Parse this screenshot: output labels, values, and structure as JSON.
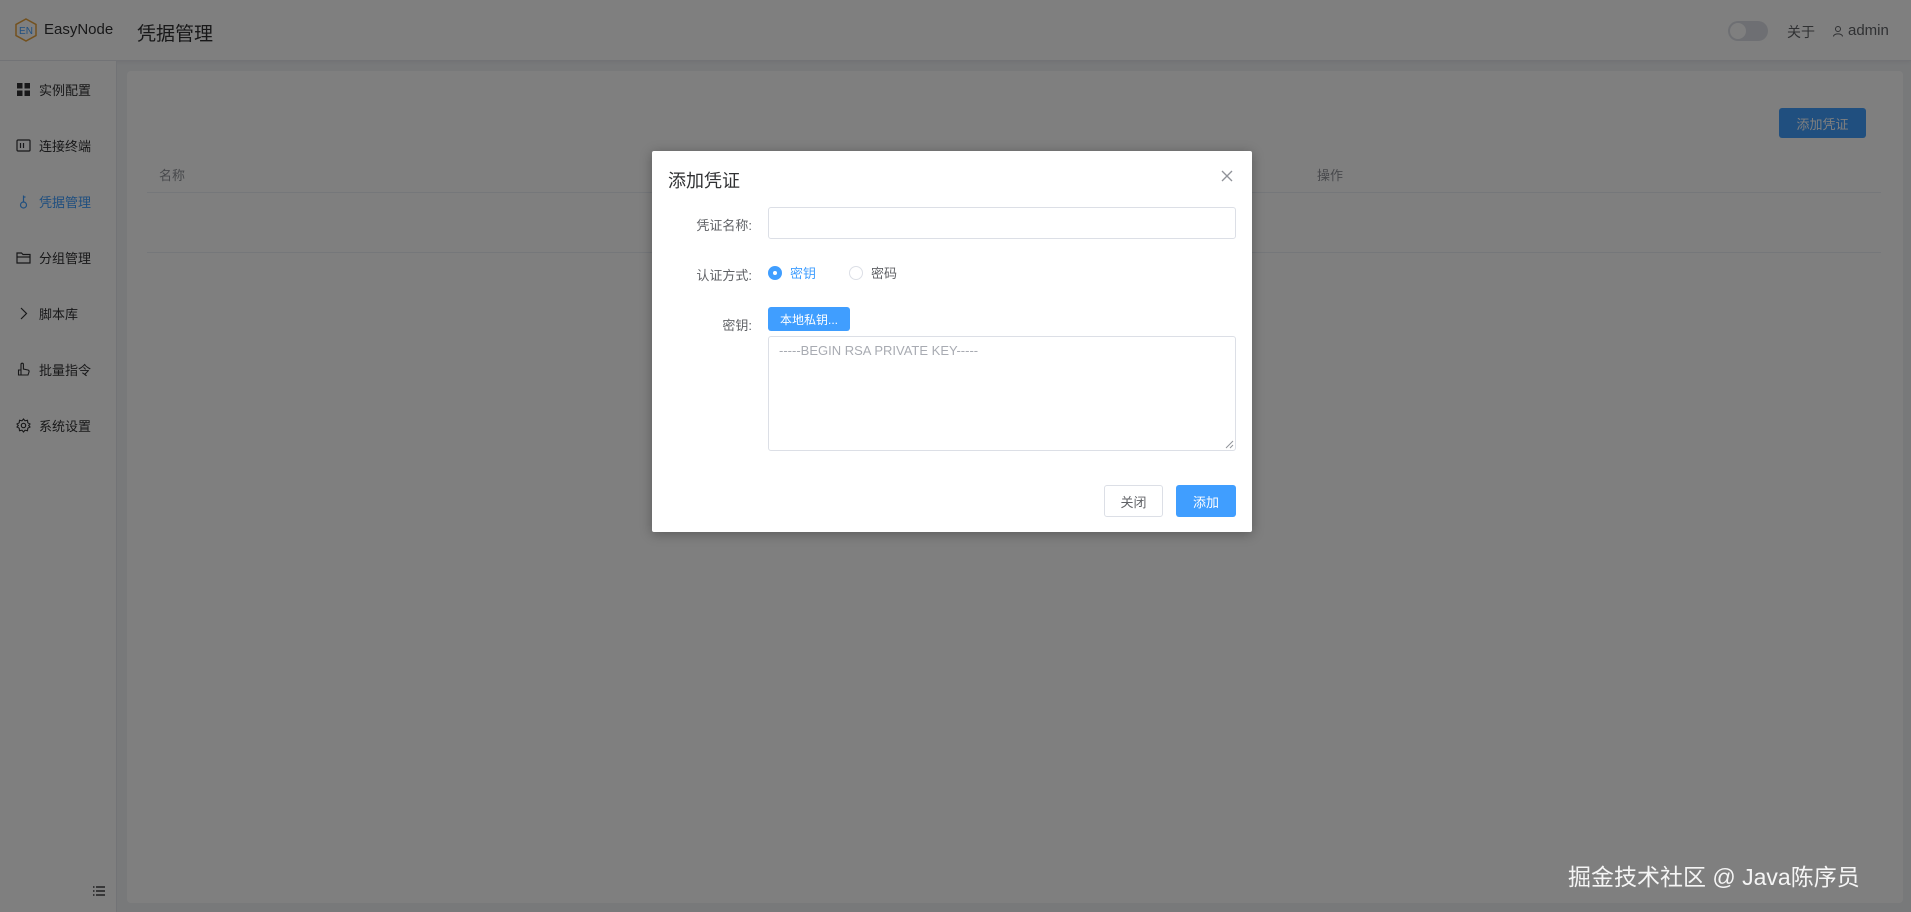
{
  "header": {
    "app_name": "EasyNode",
    "page_title": "凭据管理",
    "about": "关于",
    "user": "admin"
  },
  "sidebar": {
    "items": [
      {
        "label": "实例配置",
        "icon": "grid-icon"
      },
      {
        "label": "连接终端",
        "icon": "terminal-icon"
      },
      {
        "label": "凭据管理",
        "icon": "key-icon",
        "active": true
      },
      {
        "label": "分组管理",
        "icon": "folder-icon"
      },
      {
        "label": "脚本库",
        "icon": "chevron-right-icon"
      },
      {
        "label": "批量指令",
        "icon": "pointer-icon"
      },
      {
        "label": "系统设置",
        "icon": "gear-icon"
      }
    ]
  },
  "main": {
    "add_button": "添加凭证",
    "columns": [
      "名称",
      "操作"
    ]
  },
  "dialog": {
    "title": "添加凭证",
    "fields": {
      "name_label": "凭证名称:",
      "name_value": "",
      "auth_label": "认证方式:",
      "auth_options": [
        "密钥",
        "密码"
      ],
      "auth_selected": "密钥",
      "key_label": "密钥:",
      "local_key_button": "本地私钥...",
      "key_placeholder": "-----BEGIN RSA PRIVATE KEY-----"
    },
    "buttons": {
      "close": "关闭",
      "add": "添加"
    }
  },
  "colors": {
    "accent": "#409eff",
    "overlay": "rgba(0,0,0,0.5)"
  },
  "watermark": "掘金技术社区 @ Java陈序员"
}
